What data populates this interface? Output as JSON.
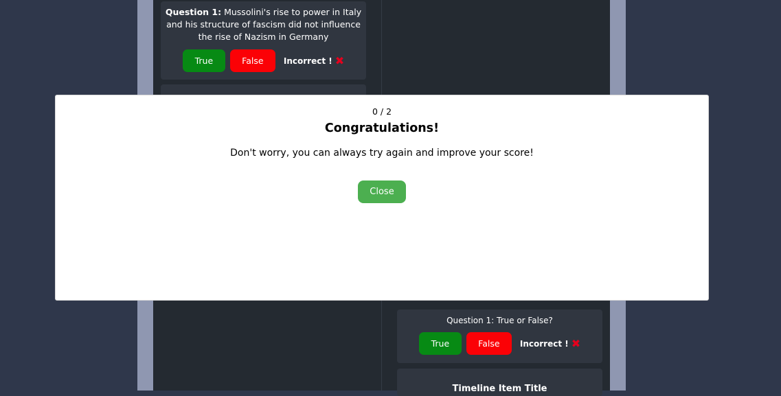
{
  "left_column": {
    "question_card": {
      "question_prefix": "Question 1:",
      "question_text": " Mussolini's rise to power in Italy and his structure of fascism did not influence the rise of Nazism in Germany",
      "true_label": "True",
      "false_label": "False",
      "result_label": "Incorrect !",
      "result_icon": "cross-icon"
    }
  },
  "right_column": {
    "question_card": {
      "question_text": "Question 1: True or False?",
      "true_label": "True",
      "false_label": "False",
      "result_label": "Incorrect !",
      "result_icon": "cross-icon"
    },
    "timeline_item": {
      "title": "Timeline Item Title"
    }
  },
  "modal": {
    "score": "0 / 2",
    "title": "Congratulations!",
    "message": "Don't worry, you can always try again and improve your score!",
    "close_label": "Close"
  },
  "colors": {
    "background": "#2f374b",
    "frame": "#8f97b1",
    "content": "#242a31",
    "card": "#303640",
    "true_button": "#078a14",
    "false_button": "#fb0106",
    "incorrect_icon": "#e5001d",
    "close_button": "#4caf50"
  }
}
